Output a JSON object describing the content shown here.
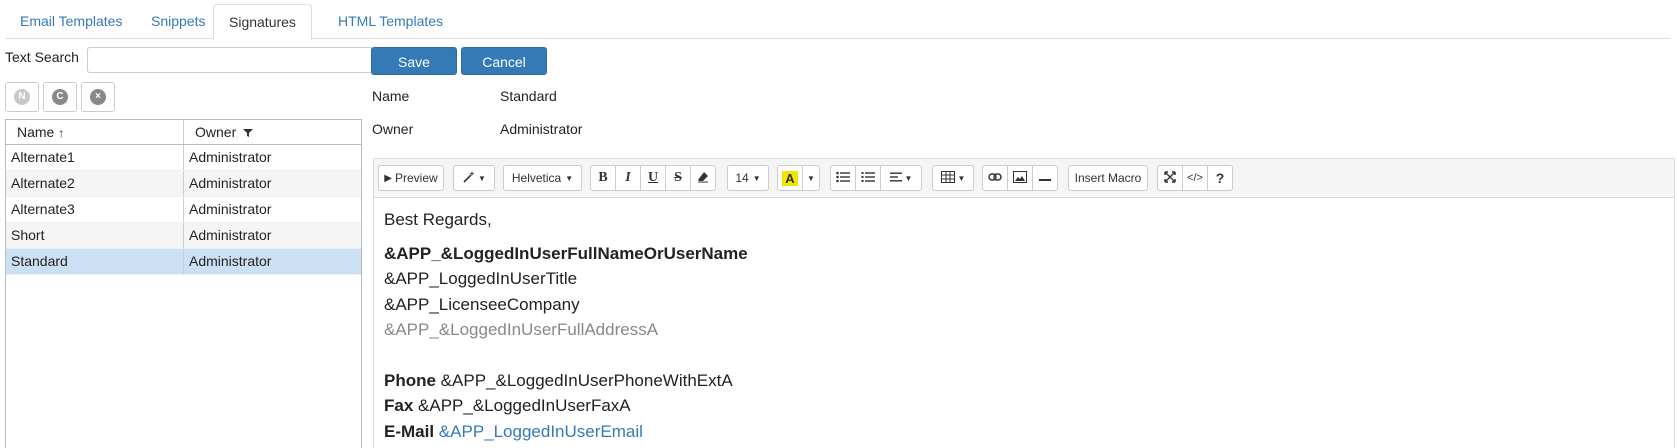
{
  "tabs": [
    "Email Templates",
    "Snippets",
    "Signatures",
    "HTML Templates"
  ],
  "search": {
    "label": "Text Search",
    "value": ""
  },
  "icon_buttons": [
    {
      "name": "new",
      "glyph": "N",
      "color": "#c8c8c8"
    },
    {
      "name": "copy",
      "glyph": "C",
      "color": "#888888"
    },
    {
      "name": "delete",
      "glyph": "×",
      "color": "#888888"
    }
  ],
  "grid": {
    "headers": {
      "name": "Name",
      "owner": "Owner"
    },
    "rows": [
      {
        "name": "Alternate1",
        "owner": "Administrator"
      },
      {
        "name": "Alternate2",
        "owner": "Administrator"
      },
      {
        "name": "Alternate3",
        "owner": "Administrator"
      },
      {
        "name": "Short",
        "owner": "Administrator"
      },
      {
        "name": "Standard",
        "owner": "Administrator"
      }
    ],
    "selected_row": "Standard"
  },
  "actions": {
    "save": "Save",
    "cancel": "Cancel"
  },
  "fields": {
    "name_label": "Name",
    "name_value": "Standard",
    "owner_label": "Owner",
    "owner_value": "Administrator"
  },
  "toolbar": {
    "preview": "Preview",
    "font_family": "Helvetica",
    "font_size": "14",
    "bold": "B",
    "italic": "I",
    "underline": "U",
    "strike": "S",
    "highlight": "A",
    "insert_macro": "Insert Macro",
    "codeview": "</>",
    "help": "?"
  },
  "signature": {
    "greeting": "Best Regards,",
    "full_name": "&APP_&LoggedInUserFullNameOrUserName",
    "title": "&APP_LoggedInUserTitle",
    "company": "&APP_LicenseeCompany",
    "address": "&APP_&LoggedInUserFullAddressA",
    "phone_label": "Phone",
    "phone_value": " &APP_&LoggedInUserPhoneWithExtA",
    "fax_label": "Fax",
    "fax_value": " &APP_&LoggedInUserFaxA",
    "email_label": "E-Mail",
    "email_value": "&APP_LoggedInUserEmail"
  },
  "colors": {
    "accent": "#337ab7",
    "selected_row": "#cce0f5",
    "highlight_yellow": "#f2e600"
  }
}
